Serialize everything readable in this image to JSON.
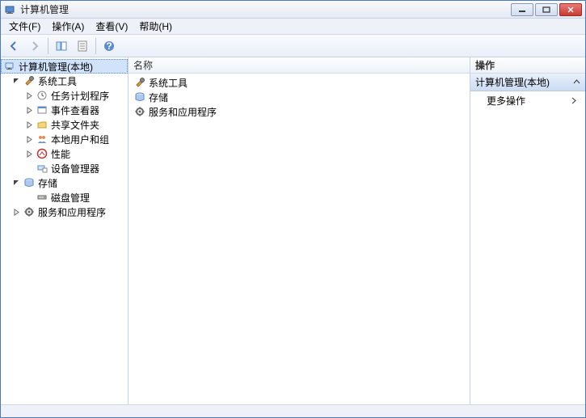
{
  "window": {
    "title": "计算机管理"
  },
  "menu": {
    "file": "文件(F)",
    "action": "操作(A)",
    "view": "查看(V)",
    "help": "帮助(H)"
  },
  "tree": {
    "root": "计算机管理(本地)",
    "system_tools": "系统工具",
    "task_scheduler": "任务计划程序",
    "event_viewer": "事件查看器",
    "shared_folders": "共享文件夹",
    "local_users": "本地用户和组",
    "performance": "性能",
    "device_manager": "设备管理器",
    "storage": "存储",
    "disk_management": "磁盘管理",
    "services_apps": "服务和应用程序"
  },
  "list": {
    "header_name": "名称",
    "items": {
      "system_tools": "系统工具",
      "storage": "存储",
      "services_apps": "服务和应用程序"
    }
  },
  "actions": {
    "header": "操作",
    "group": "计算机管理(本地)",
    "more_actions": "更多操作"
  }
}
